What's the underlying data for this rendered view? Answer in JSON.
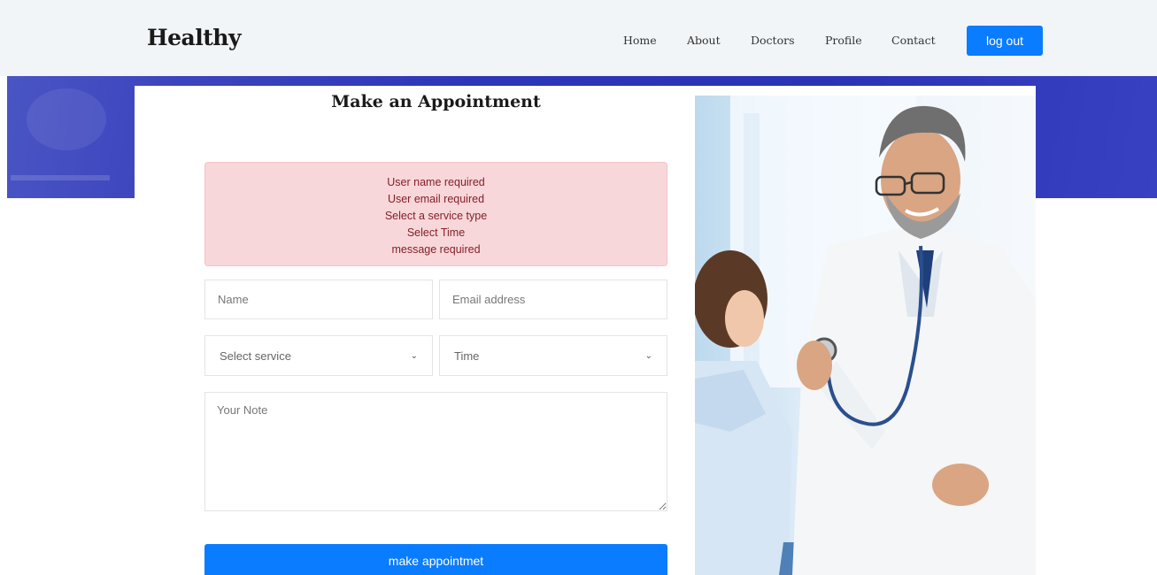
{
  "brand": "Healthy",
  "nav": {
    "items": [
      {
        "label": "Home"
      },
      {
        "label": "About"
      },
      {
        "label": "Doctors"
      },
      {
        "label": "Profile"
      },
      {
        "label": "Contact"
      }
    ],
    "logout_label": "log out"
  },
  "form": {
    "title": "Make an Appointment",
    "errors": [
      "User name required",
      "User email required",
      "Select a service type",
      "Select Time",
      "message required"
    ],
    "name_placeholder": "Name",
    "email_placeholder": "Email address",
    "service_selected": "Select service",
    "time_selected": "Time",
    "note_placeholder": "Your Note",
    "submit_label": "make appointmet"
  },
  "colors": {
    "accent": "#0a7cff",
    "alert_bg": "#f8d7da",
    "alert_text": "#842029",
    "band": "#2d36b8"
  }
}
